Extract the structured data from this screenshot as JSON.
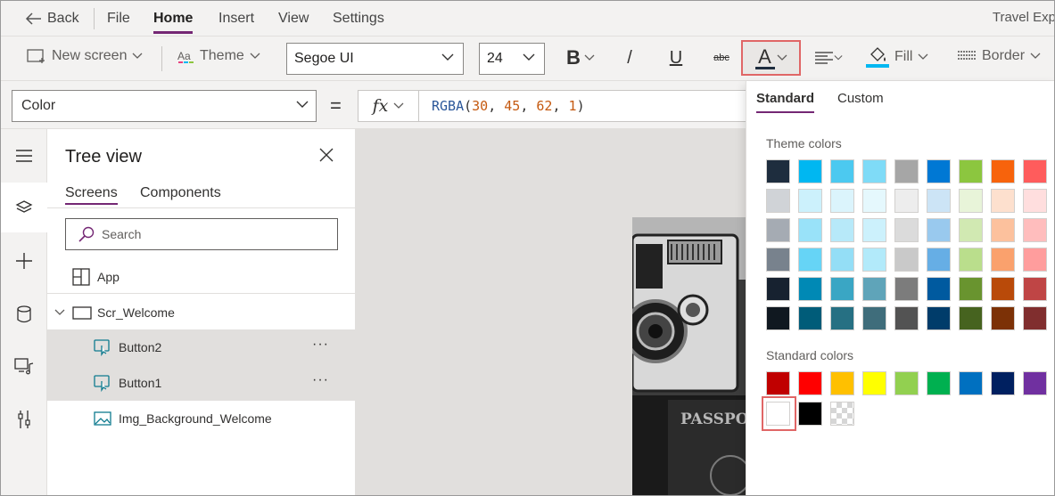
{
  "menubar": {
    "back_label": "Back",
    "items": [
      "File",
      "Home",
      "Insert",
      "View",
      "Settings"
    ],
    "active_item": "Home",
    "app_title": "Travel Exp"
  },
  "toolbar": {
    "new_screen_label": "New screen",
    "theme_label": "Theme",
    "font_family": "Segoe UI",
    "font_size": "24",
    "bold_label": "B",
    "italic_label": "/",
    "underline_label": "U",
    "strike_label": "abc",
    "fontcolor_label": "A",
    "fill_label": "Fill",
    "border_label": "Border"
  },
  "formula": {
    "property": "Color",
    "equals": "=",
    "fx_label": "fx",
    "fn": "RGBA",
    "args": [
      "30",
      "45",
      "62",
      "1"
    ]
  },
  "tree": {
    "title": "Tree view",
    "tabs": [
      "Screens",
      "Components"
    ],
    "active_tab": "Screens",
    "search_placeholder": "Search",
    "app_label": "App",
    "screen_label": "Scr_Welcome",
    "items": [
      {
        "label": "Button2",
        "selected": true,
        "icon": "button-icon"
      },
      {
        "label": "Button1",
        "selected": true,
        "icon": "button-icon"
      },
      {
        "label": "Img_Background_Welcome",
        "selected": false,
        "icon": "image-icon"
      }
    ],
    "more_label": "···"
  },
  "picker": {
    "tabs": [
      "Standard",
      "Custom"
    ],
    "active_tab": "Standard",
    "theme_colors_label": "Theme colors",
    "standard_colors_label": "Standard colors",
    "theme_colors": [
      [
        "#1e2d3e",
        "#00b7f1",
        "#4cc9f0",
        "#7fdbf7",
        "#a6a6a6",
        "#0078d4",
        "#8cc63f",
        "#f7630c",
        "#ff5c5c"
      ],
      [
        "#d0d3d7",
        "#ccf1fc",
        "#dbf4fc",
        "#e5f8fd",
        "#ededed",
        "#cce4f6",
        "#e8f4d9",
        "#fde0ce",
        "#ffdede"
      ],
      [
        "#a5abb3",
        "#99e2f9",
        "#b7e9f9",
        "#ccf1fc",
        "#dbdbdb",
        "#99c9ee",
        "#d1e9b2",
        "#fcc19d",
        "#ffbdbd"
      ],
      [
        "#78828d",
        "#66d4f6",
        "#94def6",
        "#b2eafa",
        "#c9c9c9",
        "#66aee5",
        "#bade8c",
        "#faa16d",
        "#ff9d9d"
      ],
      [
        "#172230",
        "#0089b5",
        "#3aa6c4",
        "#5fa4b9",
        "#7c7c7c",
        "#005a9f",
        "#69942f",
        "#b94a09",
        "#bf4545"
      ],
      [
        "#101820",
        "#005c79",
        "#267083",
        "#3f6d7b",
        "#535353",
        "#003c6a",
        "#46631f",
        "#7c3106",
        "#802e2e"
      ]
    ],
    "standard_colors": [
      "#c00000",
      "#ff0000",
      "#ffc000",
      "#ffff00",
      "#92d050",
      "#00b050",
      "#0070c0",
      "#002060",
      "#7030a0"
    ],
    "extra_colors": [
      "#ffffff",
      "#000000",
      "transparent"
    ]
  }
}
